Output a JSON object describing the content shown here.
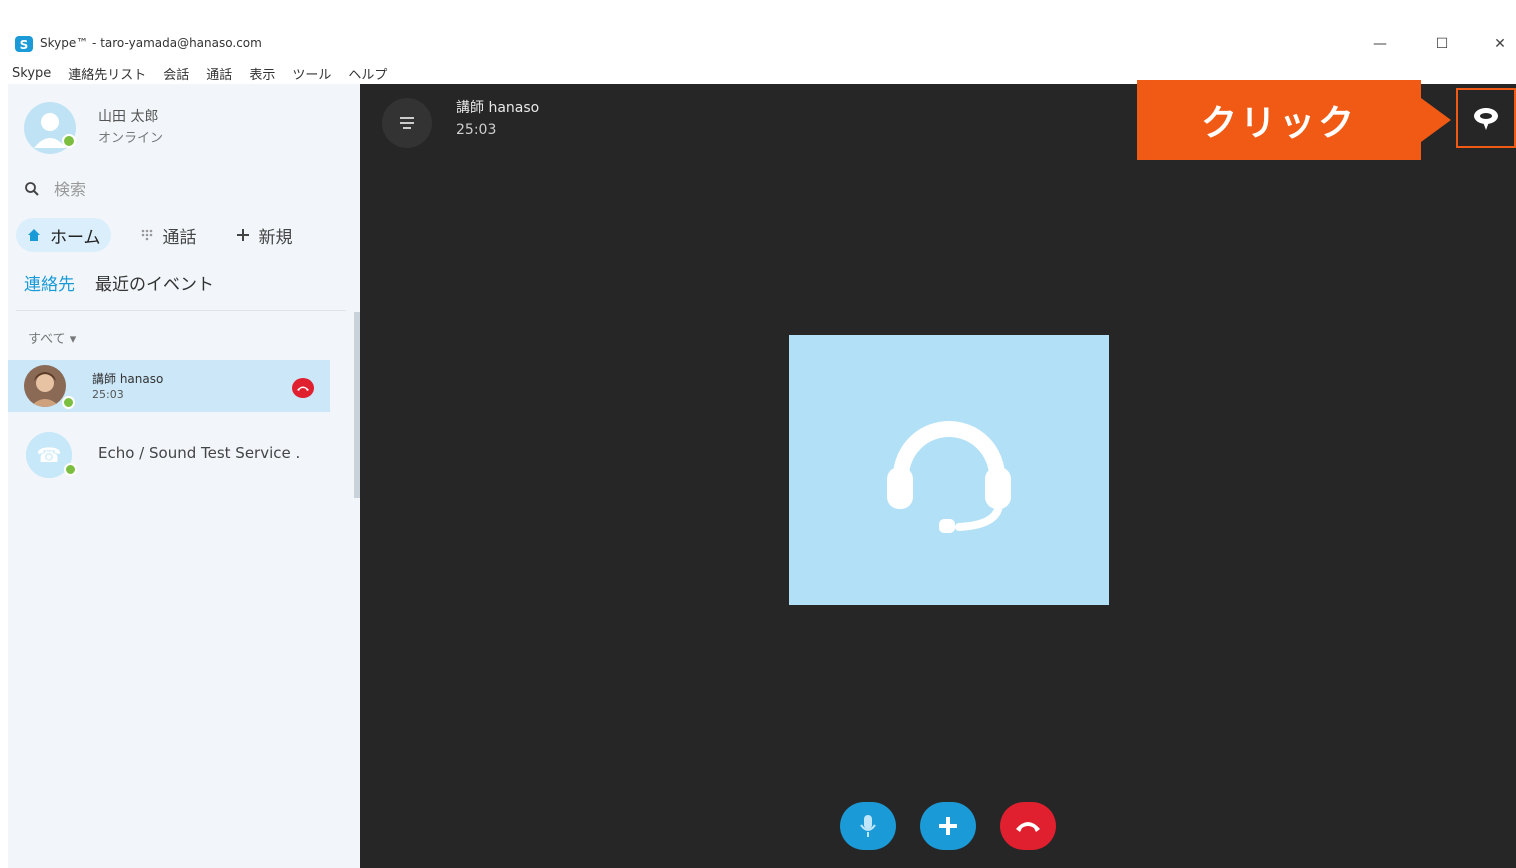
{
  "window": {
    "title": "Skype™ - taro-yamada@hanaso.com",
    "minimize": "—",
    "maximize": "☐",
    "close": "✕"
  },
  "menu": [
    "Skype",
    "連絡先リスト",
    "会話",
    "通話",
    "表示",
    "ツール",
    "ヘルプ"
  ],
  "profile": {
    "name": "山田 太郎",
    "status": "オンライン"
  },
  "search": {
    "placeholder": "検索"
  },
  "nav": {
    "home": "ホーム",
    "call": "通話",
    "new": "新規"
  },
  "tabs": {
    "contacts": "連絡先",
    "recent": "最近のイベント"
  },
  "filter": "すべて ▾",
  "contacts": [
    {
      "name": "講師 hanaso",
      "sub": "25:03"
    },
    {
      "name": "Echo / Sound Test Service ."
    }
  ],
  "call": {
    "name": "講師 hanaso",
    "time": "25:03"
  },
  "annotation": {
    "callout": "クリック"
  },
  "colors": {
    "accent": "#1a9ad6",
    "callout": "#f05a14",
    "hangup": "#e0202e",
    "online": "#7cbe3f",
    "callBackground": "#262626"
  },
  "icons": {
    "chat": "chat-bubble-icon",
    "mic": "microphone-icon",
    "add": "plus-icon",
    "hangup": "hang-up-icon",
    "placeholder": "headset-icon"
  }
}
